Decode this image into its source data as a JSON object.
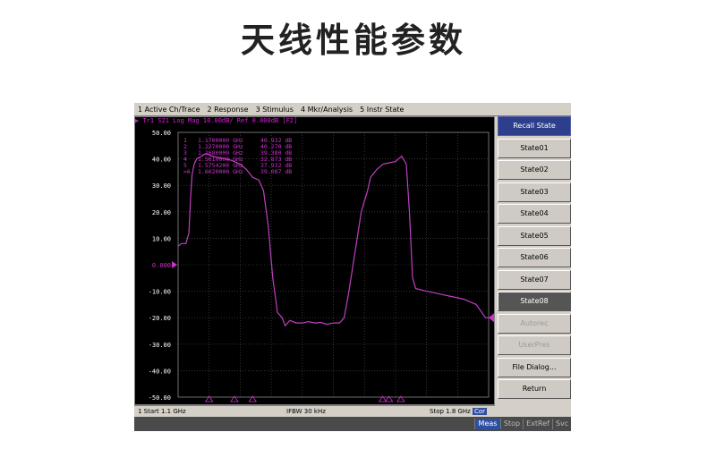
{
  "page_title": "天线性能参数",
  "menu": [
    "1 Active Ch/Trace",
    "2 Response",
    "3 Stimulus",
    "4 Mkr/Analysis",
    "5 Instr State"
  ],
  "trace_header": "▶ Tr1  S21  Log Mag 10.00dB/ Ref 0.000dB [F2]",
  "markers": [
    {
      "id": "1",
      "freq": "1.1700000 GHz",
      "value": "40.932 dB"
    },
    {
      "id": "2",
      "freq": "1.2270000 GHz",
      "value": "40.270 dB"
    },
    {
      "id": "3",
      "freq": "1.2680000 GHz",
      "value": "39.380 dB"
    },
    {
      "id": "4",
      "freq": "1.5610000 GHz",
      "value": "32.873 dB"
    },
    {
      "id": "5",
      "freq": "1.5754200 GHz",
      "value": "37.932 dB"
    },
    {
      "id": ">6",
      "freq": "1.6020000 GHz",
      "value": "39.087 dB"
    }
  ],
  "y_ticks": [
    "50.00",
    "40.00",
    "30.00",
    "20.00",
    "10.00",
    "0.000",
    "-10.00",
    "-20.00",
    "-30.00",
    "-40.00",
    "-50.00"
  ],
  "ref_tick": "0.000",
  "status": {
    "start": "1  Start 1.1 GHz",
    "ifbw": "IFBW 30 kHz",
    "stop": "Stop 1.8 GHz",
    "cor": "Cor"
  },
  "softkeys": [
    "Recall State",
    "State01",
    "State02",
    "State03",
    "State04",
    "State05",
    "State06",
    "State07",
    "State08",
    "Autorec",
    "UserPres",
    "File Dialog...",
    "Return"
  ],
  "bottom_buttons": [
    "Meas",
    "Stop",
    "ExtRef",
    "Svc"
  ],
  "trace_color": "#c040c0",
  "marker_color": "#d030d0"
}
